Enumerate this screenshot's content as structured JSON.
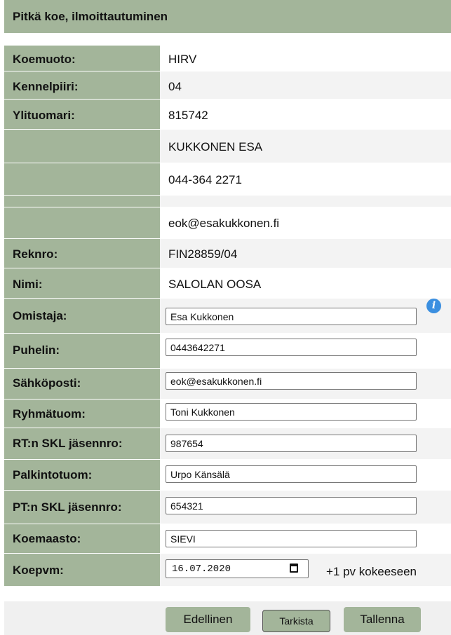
{
  "header": {
    "title": "Pitkä koe, ilmoittautuminen"
  },
  "info_rows": [
    {
      "label": "Koemuoto:",
      "value": "HIRV"
    },
    {
      "label": "Kennelpiiri:",
      "value": "04"
    },
    {
      "label": "Ylituomari:",
      "value": "815742"
    },
    {
      "label": "",
      "value": "KUKKONEN ESA"
    },
    {
      "label": "",
      "value": "044-364 2271"
    },
    {
      "label": "",
      "value": ""
    },
    {
      "label": "",
      "value": "eok@esakukkonen.fi"
    },
    {
      "label": "Reknro:",
      "value": "FIN28859/04"
    },
    {
      "label": "Nimi:",
      "value": "SALOLAN OOSA"
    }
  ],
  "form_rows": [
    {
      "label": "Omistaja:",
      "value": "Esa Kukkonen"
    },
    {
      "label": "Puhelin:",
      "value": "0443642271"
    },
    {
      "label": "Sähköposti:",
      "value": "eok@esakukkonen.fi"
    },
    {
      "label": "Ryhmätuom:",
      "value": "Toni Kukkonen"
    },
    {
      "label": "RT:n SKL jäsennro:",
      "value": "987654"
    },
    {
      "label": "Palkintotuom:",
      "value": "Urpo Känsälä"
    },
    {
      "label": "PT:n SKL jäsennro:",
      "value": "654321"
    },
    {
      "label": "Koemaasto:",
      "value": "SIEVI"
    }
  ],
  "date_row": {
    "label": "Koepvm:",
    "value": "16.07.2020",
    "note": "+1 pv kokeeseen"
  },
  "info_icon": "info-icon",
  "buttons": {
    "previous": "Edellinen",
    "check": "Tarkista",
    "save": "Tallenna"
  },
  "colors": {
    "label_bg": "#a3b59a",
    "value_bg": "#f3f3f3",
    "info_icon": "#3b8fe0"
  }
}
